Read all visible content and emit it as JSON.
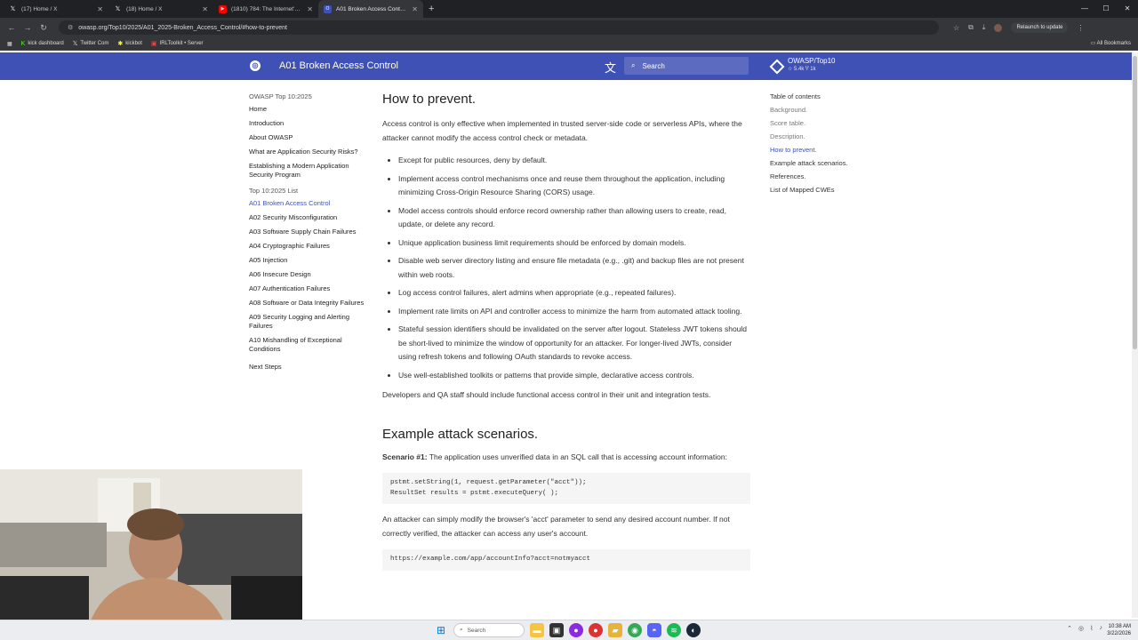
{
  "browser": {
    "tabs": [
      {
        "label": "(17) Home / X",
        "icon": "x-logo-icon",
        "color": "#ffffff"
      },
      {
        "label": "(18) Home / X",
        "icon": "x-logo-icon",
        "color": "#ffffff"
      },
      {
        "label": "(1810) 784: The Internet's Most...",
        "icon": "youtube-icon",
        "color": "#ff0000"
      },
      {
        "label": "A01 Broken Access Control - O...",
        "icon": "owasp-icon",
        "color": "#3f51b5"
      }
    ],
    "new_tab": "+",
    "url": "owasp.org/Top10/2025/A01_2025-Broken_Access_Control/#how-to-prevent",
    "relaunch_label": "Relaunch to update",
    "bookmarks": [
      {
        "label": "kick dashboard",
        "icon": "kick-icon"
      },
      {
        "label": "Twitter Com",
        "icon": "x-logo-icon"
      },
      {
        "label": "kickbot",
        "icon": "kickbot-icon"
      },
      {
        "label": "IRLToolkit • Server",
        "icon": "irltoolkit-icon"
      }
    ],
    "all_bookmarks": "All Bookmarks"
  },
  "header": {
    "title": "A01 Broken Access Control",
    "search_placeholder": "Search",
    "repo_name": "OWASP/Top10",
    "repo_stats": "☆ 5.4k  Ⴤ 1k"
  },
  "sidebar": {
    "title": "OWASP Top 10:2025",
    "items": [
      "Home",
      "Introduction",
      "About OWASP",
      "What are Application Security Risks?",
      "Establishing a Modern Application Security Program"
    ],
    "list_title": "Top 10:2025 List",
    "list_items": [
      "A01 Broken Access Control",
      "A02 Security Misconfiguration",
      "A03 Software Supply Chain Failures",
      "A04 Cryptographic Failures",
      "A05 Injection",
      "A06 Insecure Design",
      "A07 Authentication Failures",
      "A08 Software or Data Integrity Failures",
      "A09 Security Logging and Alerting Failures",
      "A10 Mishandling of Exceptional Conditions"
    ],
    "next": "Next Steps"
  },
  "toc": {
    "title": "Table of contents",
    "items": [
      "Background.",
      "Score table.",
      "Description.",
      "How to prevent.",
      "Example attack scenarios.",
      "References.",
      "List of Mapped CWEs"
    ]
  },
  "content": {
    "h_prevent": "How to prevent.",
    "p1": "Access control is only effective when implemented in trusted server-side code or serverless APIs, where the attacker cannot modify the access control check or metadata.",
    "bullets": [
      "Except for public resources, deny by default.",
      "Implement access control mechanisms once and reuse them throughout the application, including minimizing Cross-Origin Resource Sharing (CORS) usage.",
      "Model access controls should enforce record ownership rather than allowing users to create, read, update, or delete any record.",
      "Unique application business limit requirements should be enforced by domain models.",
      "Disable web server directory listing and ensure file metadata (e.g., .git) and backup files are not present within web roots.",
      "Log access control failures, alert admins when appropriate (e.g., repeated failures).",
      "Implement rate limits on API and controller access to minimize the harm from automated attack tooling.",
      "Stateful session identifiers should be invalidated on the server after logout. Stateless JWT tokens should be short-lived to minimize the window of opportunity for an attacker. For longer-lived JWTs, consider using refresh tokens and following OAuth standards to revoke access.",
      "Use well-established toolkits or patterns that provide simple, declarative access controls."
    ],
    "p2": "Developers and QA staff should include functional access control in their unit and integration tests.",
    "h_examples": "Example attack scenarios.",
    "scenario1_label": "Scenario #1:",
    "scenario1_text": " The application uses unverified data in an SQL call that is accessing account information:",
    "code1": "pstmt.setString(1, request.getParameter(\"acct\"));\nResultSet results = pstmt.executeQuery( );",
    "p3": "An attacker can simply modify the browser's 'acct' parameter to send any desired account number. If not correctly verified, the attacker can access any user's account.",
    "code2": "https://example.com/app/accountInfo?acct=notmyacct"
  },
  "taskbar": {
    "search_label": "Search",
    "time": "10:38 AM",
    "date": "3/22/2026"
  }
}
